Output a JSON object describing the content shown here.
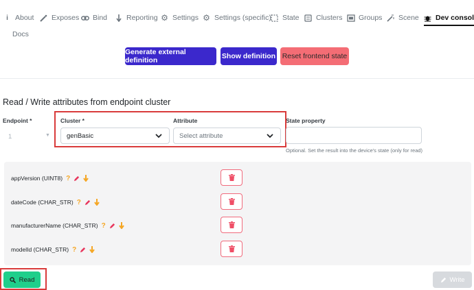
{
  "tabs": [
    {
      "label": "About",
      "icon": "info-icon"
    },
    {
      "label": "Exposes",
      "icon": "wand-icon"
    },
    {
      "label": "Bind",
      "icon": "link-icon"
    },
    {
      "label": "Reporting",
      "icon": "arrow-down-icon"
    },
    {
      "label": "Settings",
      "icon": "cog-icon"
    },
    {
      "label": "Settings (specific)",
      "icon": "cogs-icon"
    },
    {
      "label": "State",
      "icon": "state-icon"
    },
    {
      "label": "Clusters",
      "icon": "clusters-icon"
    },
    {
      "label": "Groups",
      "icon": "groups-icon"
    },
    {
      "label": "Scene",
      "icon": "scene-icon"
    },
    {
      "label": "Dev console",
      "icon": "bug-icon",
      "active": true
    },
    {
      "label": "Docs",
      "icon": ""
    }
  ],
  "actions": {
    "generate": "Generate external definition",
    "show": "Show definition",
    "reset": "Reset frontend state"
  },
  "section_title": "Read / Write attributes from endpoint cluster",
  "form": {
    "endpoint_label": "Endpoint *",
    "endpoint_value": "1",
    "cluster_label": "Cluster *",
    "cluster_value": "genBasic",
    "attribute_label": "Attribute",
    "attribute_placeholder": "Select attribute",
    "state_label": "State property",
    "state_help": "Optional. Set the result into the device's state (only for read)"
  },
  "attributes": [
    {
      "name": "appVersion (UINT8)"
    },
    {
      "name": "dateCode (CHAR_STR)"
    },
    {
      "name": "manufacturerName (CHAR_STR)"
    },
    {
      "name": "modelId (CHAR_STR)"
    }
  ],
  "buttons": {
    "read": "Read",
    "write": "Write"
  },
  "colors": {
    "primary": "#3b28cc",
    "danger": "#f46d75",
    "success": "#1fcf8b",
    "highlight": "#d93a3a"
  }
}
